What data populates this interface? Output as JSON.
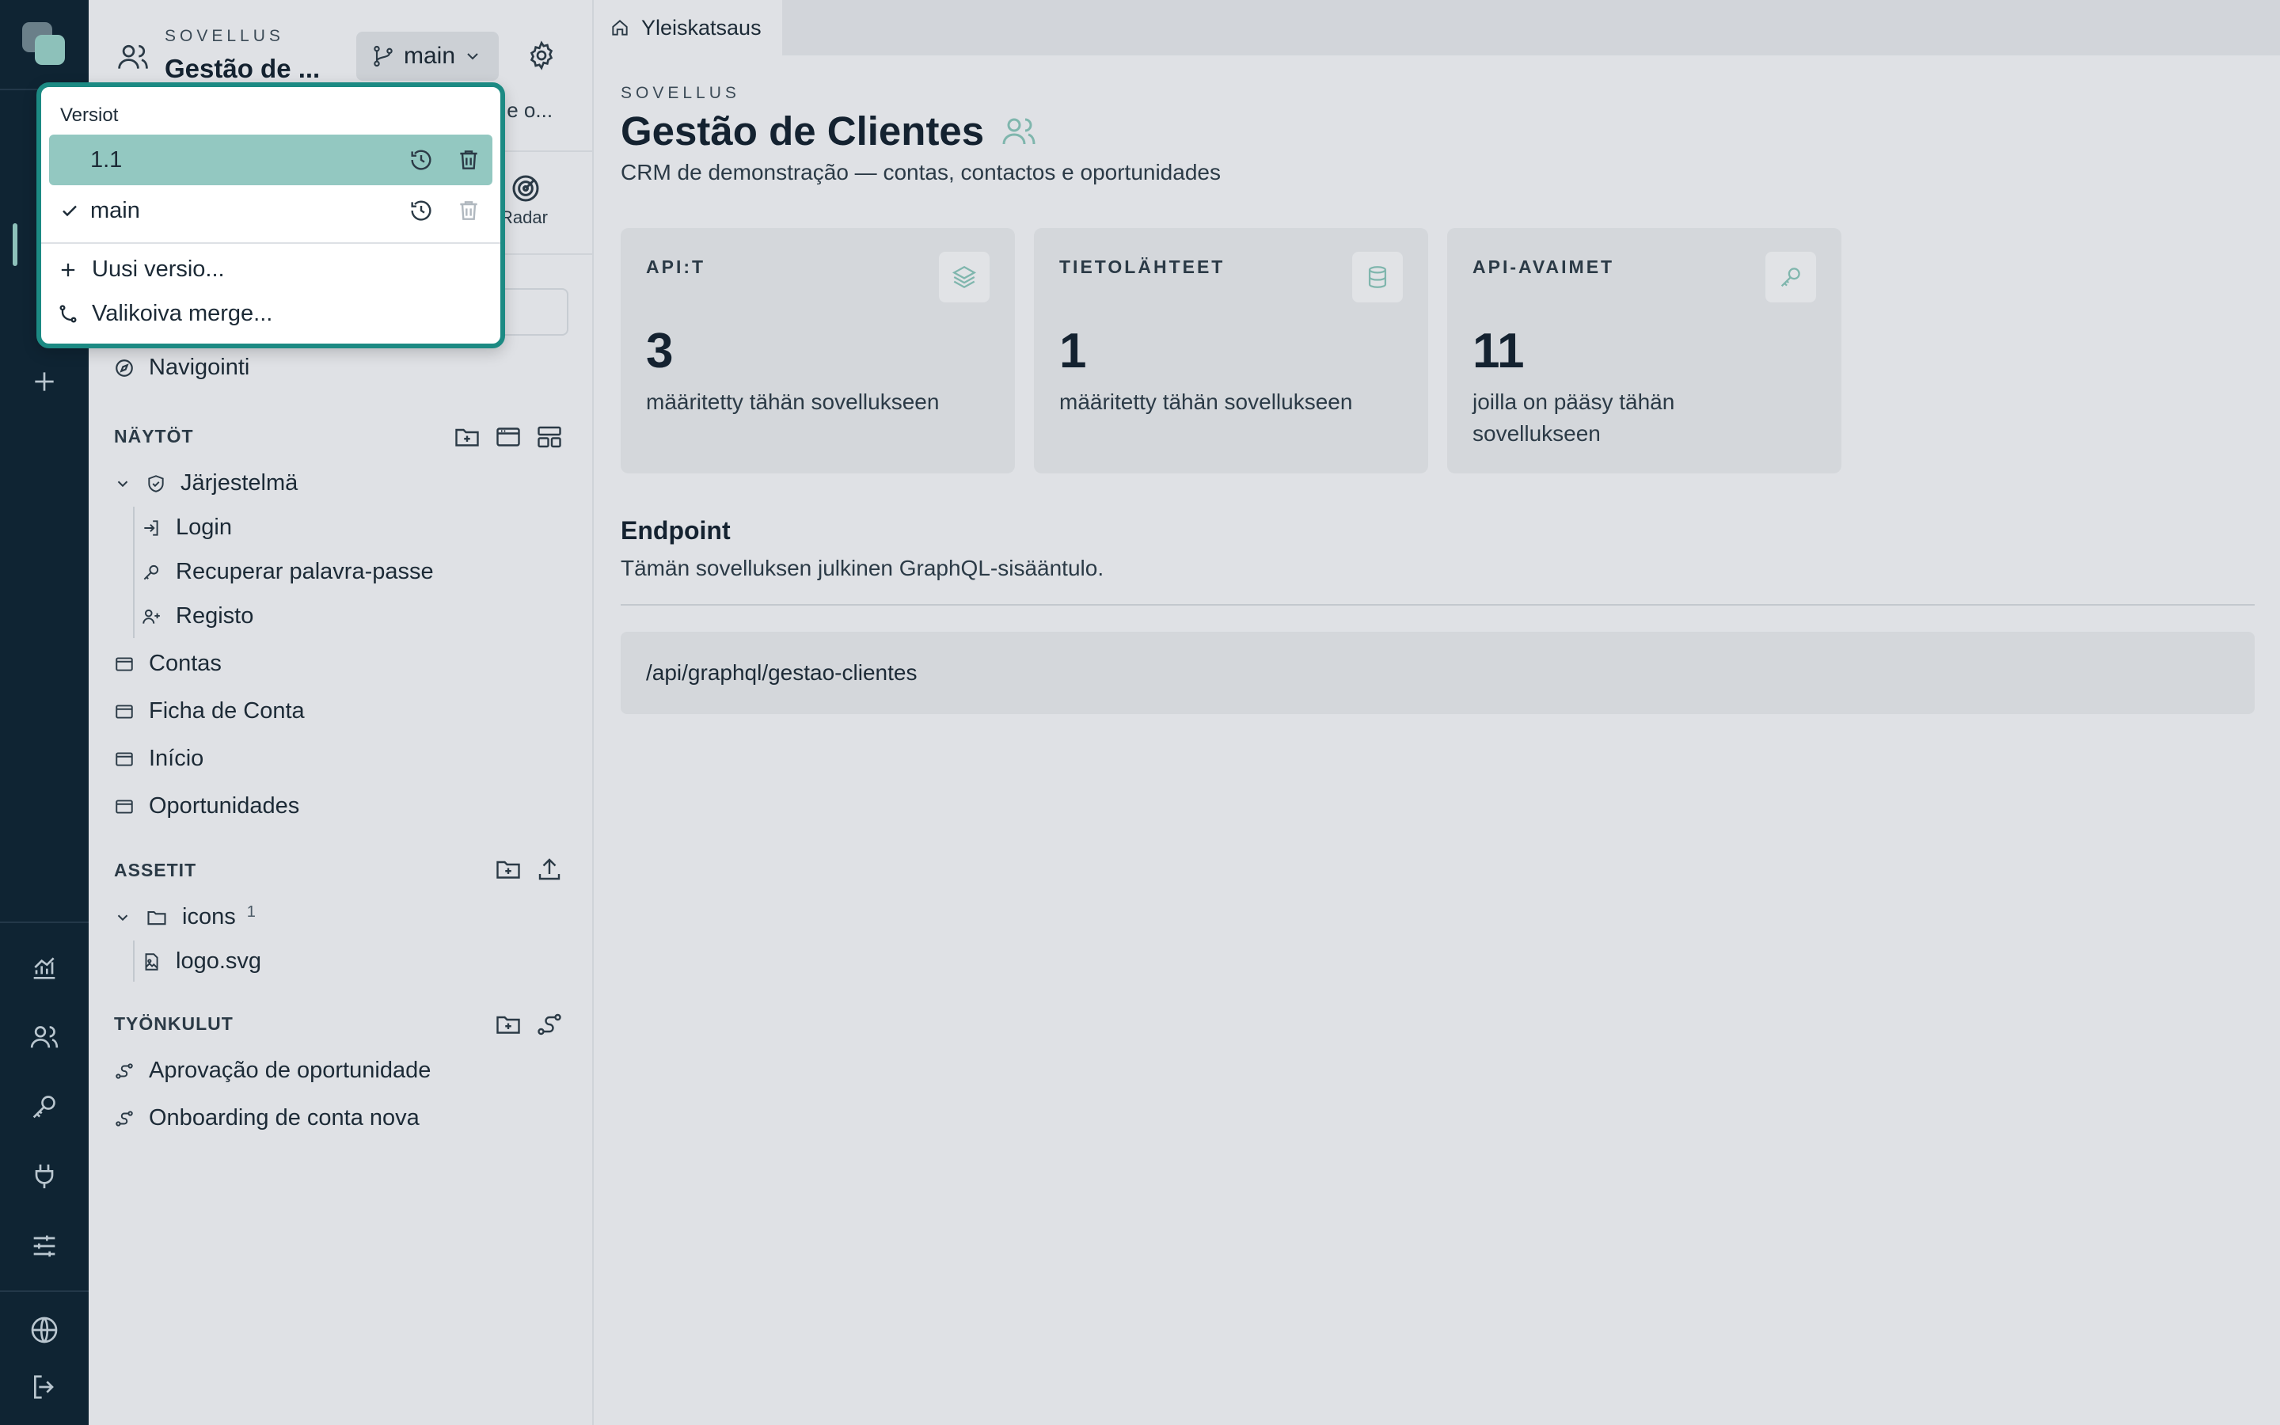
{
  "sidebar": {
    "overline": "SOVELLUS",
    "app_title": "Gestão de ...",
    "branch": "main",
    "description_fragment": "s e o...",
    "radar_label": "Radar",
    "navigation": "Navigointi",
    "views": {
      "heading": "NÄYTÖT",
      "group": "Järjestelmä",
      "group_items": [
        "Login",
        "Recuperar palavra-passe",
        "Registo"
      ],
      "items": [
        "Contas",
        "Ficha de Conta",
        "Início",
        "Oportunidades"
      ]
    },
    "assets": {
      "heading": "ASSETIT",
      "folder": "icons",
      "folder_count": "1",
      "file": "logo.svg"
    },
    "workflows": {
      "heading": "TYÖNKULUT",
      "items": [
        "Aprovação de oportunidade",
        "Onboarding de conta nova"
      ]
    }
  },
  "versions_dropdown": {
    "heading": "Versiot",
    "versions": [
      {
        "label": "1.1",
        "selected": true,
        "current": false
      },
      {
        "label": "main",
        "selected": false,
        "current": true
      }
    ],
    "new_version": "Uusi versio...",
    "selective_merge": "Valikoiva merge..."
  },
  "main": {
    "tab": "Yleiskatsaus",
    "overline": "SOVELLUS",
    "title": "Gestão de Clientes",
    "description": "CRM de demonstração — contas, contactos e oportunidades",
    "cards": [
      {
        "label": "API:T",
        "value": "3",
        "sub": "määritetty tähän sovellukseen",
        "icon": "layers-icon"
      },
      {
        "label": "TIETOLÄHTEET",
        "value": "1",
        "sub": "määritetty tähän sovellukseen",
        "icon": "database-icon"
      },
      {
        "label": "API-AVAIMET",
        "value": "11",
        "sub": "joilla on pääsy tähän sovellukseen",
        "icon": "key-icon"
      }
    ],
    "endpoint": {
      "title": "Endpoint",
      "description": "Tämän sovelluksen julkinen GraphQL-sisääntulo.",
      "path": "/api/graphql/gestao-clientes"
    }
  },
  "colors": {
    "rail": "#0f2433",
    "accent": "#1c8a83",
    "accent_soft": "#93c8c1",
    "background": "#dfe1e5"
  }
}
